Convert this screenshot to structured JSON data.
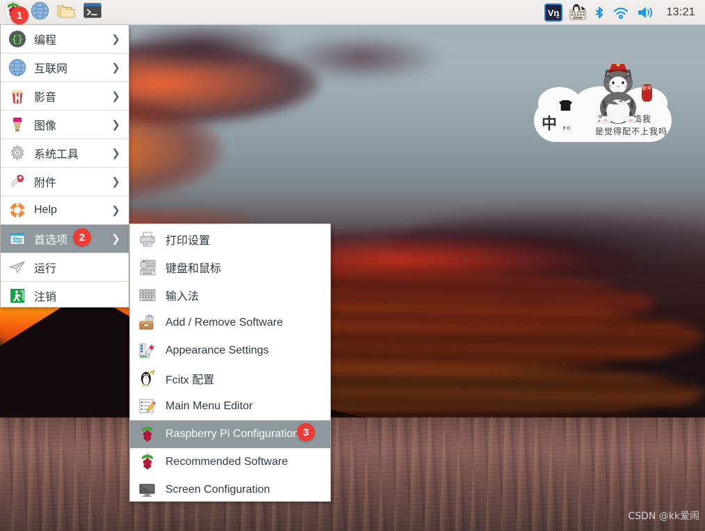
{
  "panel": {
    "launchers": [
      {
        "name": "raspberry-menu-button",
        "icon": "raspberry-icon",
        "label": "Menu"
      },
      {
        "name": "web-browser-launcher",
        "icon": "globe-icon",
        "label": "Web Browser"
      },
      {
        "name": "file-manager-launcher",
        "icon": "folder-icon",
        "label": "File Manager"
      },
      {
        "name": "terminal-launcher",
        "icon": "terminal-icon",
        "label": "Terminal"
      }
    ],
    "tray": [
      {
        "name": "vnc-tray-icon",
        "icon": "vnc-icon",
        "label": "VNC"
      },
      {
        "name": "fcitx-tray-icon",
        "icon": "keyboard-penguin-icon",
        "label": "Fcitx"
      },
      {
        "name": "bluetooth-tray-icon",
        "icon": "bluetooth-icon",
        "label": "Bluetooth"
      },
      {
        "name": "wifi-tray-icon",
        "icon": "wifi-icon",
        "label": "Wireless Network"
      },
      {
        "name": "volume-tray-icon",
        "icon": "speaker-icon",
        "label": "Volume"
      }
    ],
    "clock": "13:21"
  },
  "main_menu": {
    "items": [
      {
        "label": "编程",
        "icon": "code-braces-icon",
        "arrow": "❯",
        "selected": false
      },
      {
        "label": "互联网",
        "icon": "globe-icon",
        "arrow": "❯",
        "selected": false
      },
      {
        "label": "影音",
        "icon": "popcorn-icon",
        "arrow": "❯",
        "selected": false
      },
      {
        "label": "图像",
        "icon": "paintbrush-icon",
        "arrow": "❯",
        "selected": false
      },
      {
        "label": "系统工具",
        "icon": "gear-icon",
        "arrow": "❯",
        "selected": false
      },
      {
        "label": "附件",
        "icon": "swiss-knife-icon",
        "arrow": "❯",
        "selected": false
      },
      {
        "label": "Help",
        "icon": "lifebuoy-icon",
        "arrow": "❯",
        "selected": false
      },
      {
        "label": "首选项",
        "icon": "preferences-icon",
        "arrow": "❯",
        "selected": true
      },
      {
        "label": "运行",
        "icon": "paper-plane-icon",
        "arrow": "",
        "selected": false
      },
      {
        "label": "注销",
        "icon": "logout-icon",
        "arrow": "",
        "selected": false
      }
    ]
  },
  "submenu": {
    "parent": "首选项",
    "items": [
      {
        "label": "打印设置",
        "icon": "printer-icon",
        "selected": false
      },
      {
        "label": "键盘和鼠标",
        "icon": "keyboard-mouse-icon",
        "selected": false
      },
      {
        "label": "输入法",
        "icon": "input-method-icon",
        "selected": false
      },
      {
        "label": "Add / Remove Software",
        "icon": "software-package-icon",
        "selected": false
      },
      {
        "label": "Appearance Settings",
        "icon": "appearance-palette-icon",
        "selected": false
      },
      {
        "label": "Fcitx 配置",
        "icon": "penguin-icon",
        "selected": false
      },
      {
        "label": "Main Menu Editor",
        "icon": "menu-editor-icon",
        "selected": false
      },
      {
        "label": "Raspberry Pi Configuration",
        "icon": "raspberry-icon",
        "selected": true
      },
      {
        "label": "Recommended Software",
        "icon": "raspberry-icon",
        "selected": false
      },
      {
        "label": "Screen Configuration",
        "icon": "monitor-icon",
        "selected": false
      }
    ]
  },
  "badges": [
    {
      "id": "badge-1",
      "text": "1"
    },
    {
      "id": "badge-2",
      "text": "2"
    },
    {
      "id": "badge-3",
      "text": "3"
    }
  ],
  "fcitx_panel": {
    "mode": "中",
    "punct": "，。",
    "line1": "为什么不捣我",
    "line2": "是觉得配不上我吗",
    "lantern": "新年"
  },
  "watermark": "CSDN @kk爱闹",
  "colors": {
    "badge": "#ee3b34",
    "menu_highlight": "#8f989d",
    "panel_bg": "#efedeb",
    "menu_bg": "#ffffff",
    "text": "#2f3b43"
  }
}
